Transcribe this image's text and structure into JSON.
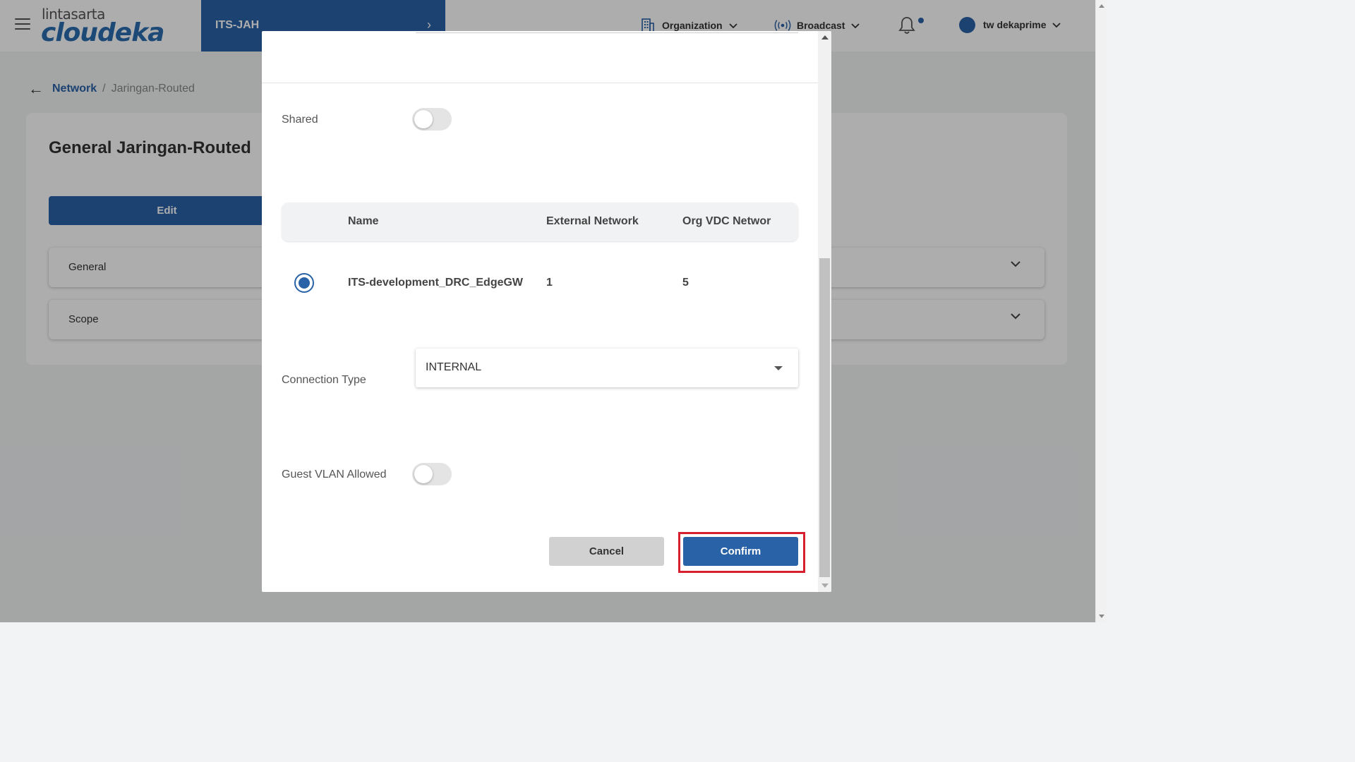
{
  "header": {
    "logo_top": "lintasarta",
    "logo_main": "cloudeka",
    "org_tab": {
      "label": "ITS-JAH",
      "chevron": "›"
    },
    "organization_label": "Organization",
    "broadcast_label": "Broadcast",
    "user_name": "tw dekaprime",
    "icons": [
      "menu-icon",
      "building-icon",
      "broadcast-icon",
      "bell-icon",
      "chevron-down-icon"
    ]
  },
  "breadcrumb": {
    "back": "←",
    "parent": "Network",
    "separator": "/",
    "current": "Jaringan-Routed"
  },
  "page": {
    "title": "General Jaringan-Routed",
    "edit_label": "Edit",
    "sections": [
      "General",
      "Scope"
    ]
  },
  "modal": {
    "shared_label": "Shared",
    "shared_on": false,
    "table": {
      "headers": [
        "Name",
        "External Network",
        "Org VDC Networ"
      ],
      "rows": [
        {
          "selected": true,
          "name": "ITS-development_DRC_EdgeGW",
          "external_network": "1",
          "org_vdc_network": "5"
        }
      ]
    },
    "connection_type_label": "Connection Type",
    "connection_type_value": "INTERNAL",
    "guest_vlan_label": "Guest VLAN Allowed",
    "guest_vlan_on": false,
    "cancel_label": "Cancel",
    "confirm_label": "Confirm"
  },
  "colors": {
    "primary": "#2a62a8",
    "highlight": "#d62030",
    "cancel_bg": "#d1d1d1"
  }
}
